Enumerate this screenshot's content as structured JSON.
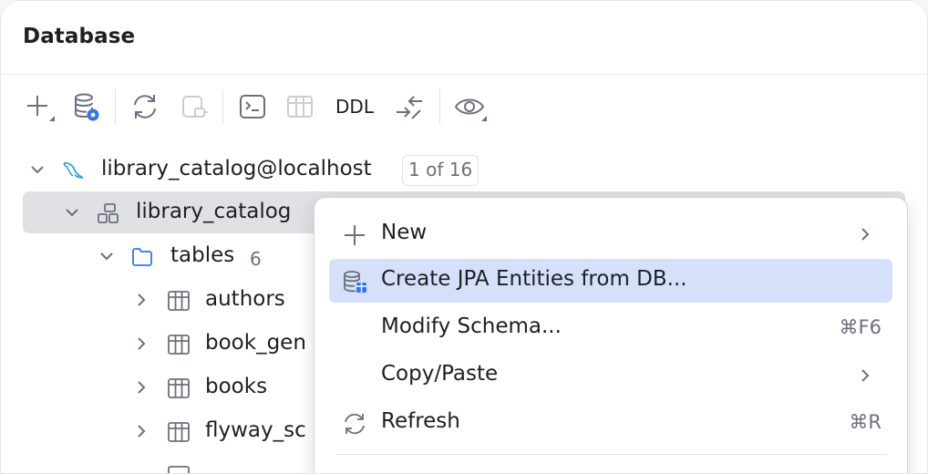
{
  "header": {
    "title": "Database"
  },
  "toolbar": {
    "items": [
      {
        "name": "add-icon"
      },
      {
        "name": "data-source-properties-icon"
      },
      {
        "name": "refresh-icon"
      },
      {
        "name": "disconnect-icon"
      },
      {
        "name": "console-icon"
      },
      {
        "name": "table-view-icon"
      },
      {
        "name": "ddl-button",
        "label": "DDL"
      },
      {
        "name": "jump-to-icon"
      },
      {
        "name": "view-options-icon"
      }
    ]
  },
  "tree": {
    "connection": {
      "label": "library_catalog@localhost",
      "badge": "1 of 16"
    },
    "schema": {
      "label": "library_catalog"
    },
    "folder": {
      "label": "tables",
      "count": "6"
    },
    "tables": [
      {
        "label": "authors"
      },
      {
        "label": "book_gen"
      },
      {
        "label": "books"
      },
      {
        "label": "flyway_sc"
      }
    ]
  },
  "context_menu": {
    "items": [
      {
        "label": "New",
        "icon": "plus-icon",
        "submenu": true
      },
      {
        "label": "Create JPA Entities from DB...",
        "icon": "database-entities-icon",
        "highlighted": true
      },
      {
        "label": "Modify Schema...",
        "shortcut": "⌘F6"
      },
      {
        "label": "Copy/Paste",
        "submenu": true
      },
      {
        "label": "Refresh",
        "icon": "refresh-icon",
        "shortcut": "⌘R"
      }
    ]
  },
  "colors": {
    "selection": "#dfe1e5",
    "menu_highlight": "#d5e1fa",
    "accent_blue": "#3574f0",
    "icon_gray": "#6c707e"
  }
}
